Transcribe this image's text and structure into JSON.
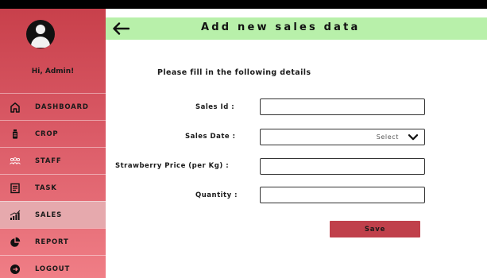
{
  "sidebar": {
    "greeting": "Hi, Admin!",
    "items": [
      {
        "label": "DASHBOARD",
        "icon": "home-icon",
        "active": false
      },
      {
        "label": "CROP",
        "icon": "crop-icon",
        "active": false
      },
      {
        "label": "STAFF",
        "icon": "staff-icon",
        "active": false
      },
      {
        "label": "TASK",
        "icon": "task-icon",
        "active": false
      },
      {
        "label": "SALES",
        "icon": "sales-chart-icon",
        "active": true
      },
      {
        "label": "REPORT",
        "icon": "pie-chart-icon",
        "active": false
      },
      {
        "label": "LOGOUT",
        "icon": "logout-icon",
        "active": false
      }
    ]
  },
  "header": {
    "title": "Add new sales data",
    "back_icon": "back-arrow-icon"
  },
  "form": {
    "instruction": "Please fill in the following details",
    "sales_id_label": "Sales Id :",
    "sales_id_value": "",
    "sales_date_label": "Sales Date :",
    "sales_date_selected": "Select",
    "price_label": "Strawberry Price (per Kg) :",
    "price_value": "",
    "quantity_label": "Quantity :",
    "quantity_value": "",
    "save_label": "Save"
  },
  "colors": {
    "sidebar_top": "#c8404b",
    "sidebar_bottom": "#f07e86",
    "header_bg": "#b8f0aa",
    "save_button": "#c0404b"
  }
}
